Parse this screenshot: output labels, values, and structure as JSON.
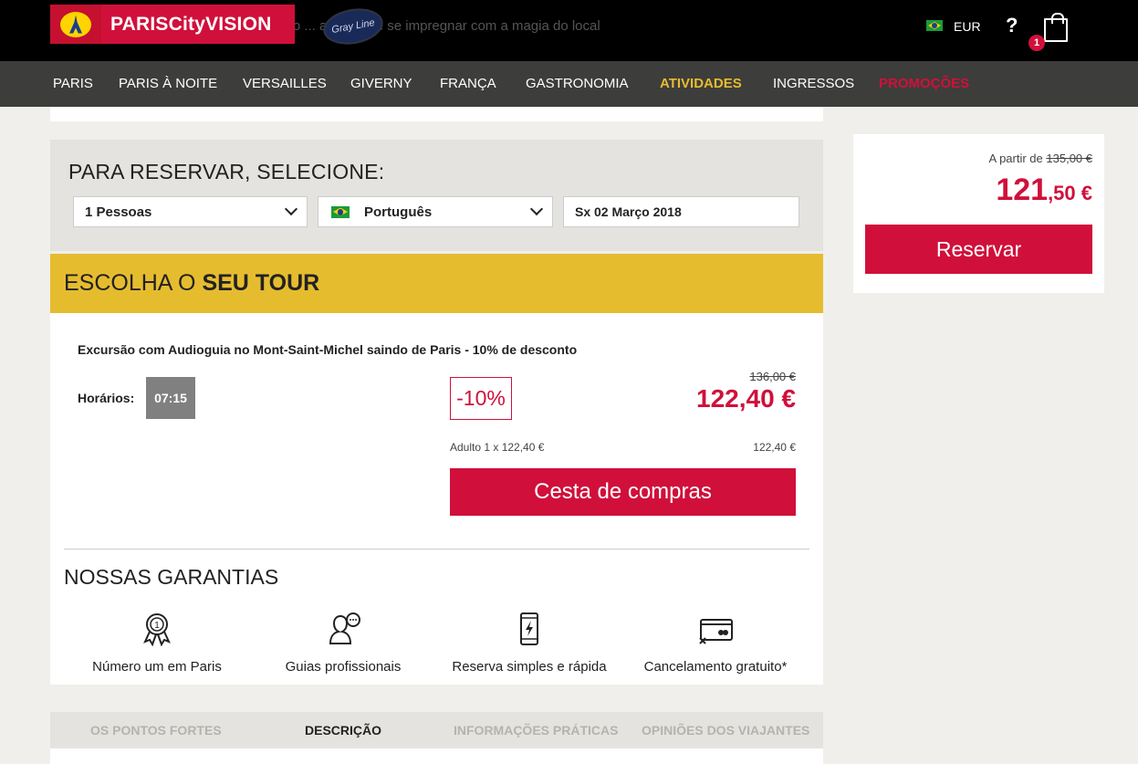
{
  "topbar": {
    "ticker": "e do ... animado e se impregnar com a magia do local",
    "logo_text": "PARISCityVISION",
    "partner_logo": "Gray Line",
    "currency": "EUR",
    "help": "?",
    "cart_count": "1"
  },
  "nav": {
    "items": [
      "PARIS",
      "PARIS À NOITE",
      "VERSAILLES",
      "GIVERNY",
      "FRANÇA",
      "GASTRONOMIA",
      "ATIVIDADES",
      "INGRESSOS",
      "PROMOÇÕES"
    ]
  },
  "booking": {
    "title": "PARA RESERVAR, SELECIONE:",
    "people": "1 Pessoas",
    "language": "Português",
    "date": "Sx 02 Março 2018"
  },
  "tour": {
    "header_prefix": "ESCOLHA O",
    "header_bold": "SEU TOUR",
    "name": "Excursão com Audioguia no Mont-Saint-Michel saindo de Paris - 10% de desconto",
    "schedule_label": "Horários:",
    "time": "07:15",
    "discount": "-10%",
    "old_price": "136,00 €",
    "new_price": "122,40 €",
    "adult_line": "Adulto 1 x 122,40 €",
    "adult_total": "122,40 €",
    "cart_button": "Cesta de compras"
  },
  "guarantees": {
    "title": "NOSSAS GARANTIAS",
    "items": [
      {
        "label": "Número um em Paris",
        "icon": "award-ribbon-icon"
      },
      {
        "label": "Guias profissionais",
        "icon": "guide-chat-icon"
      },
      {
        "label": "Reserva simples e rápida",
        "icon": "phone-bolt-icon"
      },
      {
        "label": "Cancelamento gratuito*",
        "icon": "credit-card-cancel-icon"
      }
    ]
  },
  "tabs": [
    "OS PONTOS FORTES",
    "DESCRIÇÃO",
    "INFORMAÇÕES PRÁTICAS",
    "OPINIÕES DOS VIAJANTES"
  ],
  "active_tab": "DESCRIÇÃO",
  "sidebar": {
    "from_label": "A partir de",
    "from_old_price": "135,00 €",
    "price_int": "121",
    "price_dec": ",50 €",
    "reserve_button": "Reservar"
  },
  "colors": {
    "brand_red": "#d0103a",
    "accent_yellow": "#e6bc2f",
    "nav_bg": "#3d3d3b"
  }
}
